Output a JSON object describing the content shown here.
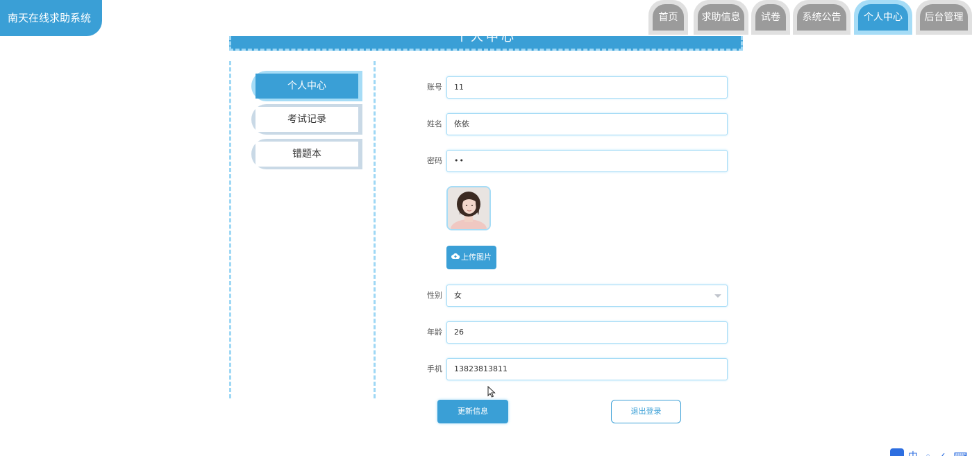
{
  "app": {
    "title": "南天在线求助系统"
  },
  "nav": {
    "tabs": [
      {
        "label": "首页"
      },
      {
        "label": "求助信息"
      },
      {
        "label": "试卷"
      },
      {
        "label": "系统公告"
      },
      {
        "label": "个人中心",
        "active": true
      },
      {
        "label": "后台管理"
      }
    ]
  },
  "page": {
    "title": "个人中心"
  },
  "sidebar": {
    "items": [
      {
        "label": "个人中心",
        "active": true
      },
      {
        "label": "考试记录"
      },
      {
        "label": "错题本"
      }
    ]
  },
  "form": {
    "account": {
      "label": "账号",
      "value": "11"
    },
    "name": {
      "label": "姓名",
      "value": "依依"
    },
    "password": {
      "label": "密码",
      "value": "••"
    },
    "upload_label": "上传图片",
    "gender": {
      "label": "性别",
      "value": "女"
    },
    "age": {
      "label": "年龄",
      "value": "26"
    },
    "phone": {
      "label": "手机",
      "value": "13823813811"
    }
  },
  "actions": {
    "update_label": "更新信息",
    "logout_label": "退出登录"
  },
  "colors": {
    "accent": "#3a9fd6",
    "accent_light": "#a6dcf6",
    "tab_gray": "#9b9b9b"
  }
}
